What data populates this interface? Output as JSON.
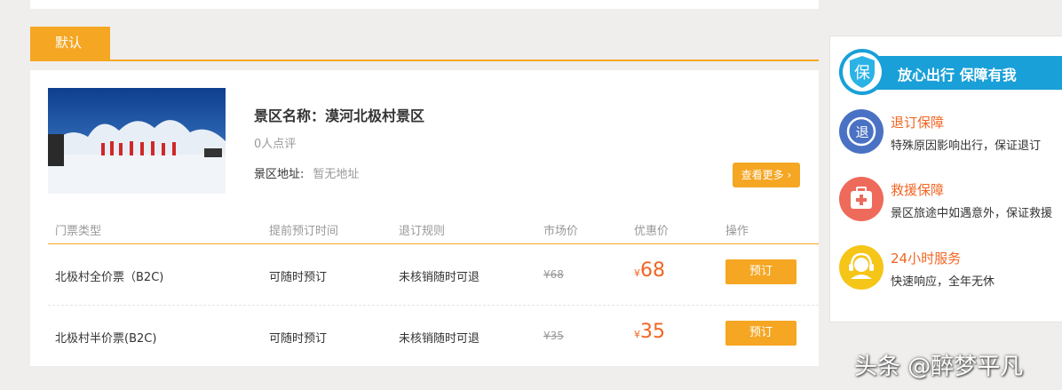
{
  "tab": {
    "label": "默认"
  },
  "scenic": {
    "title": "景区名称：漠河北极村景区",
    "reviews": "0人点评",
    "address_label": "景区地址:",
    "address_value": "暂无地址",
    "more_button": "查看更多"
  },
  "table": {
    "headers": [
      "门票类型",
      "提前预订时间",
      "退订规则",
      "市场价",
      "优惠价",
      "操作"
    ],
    "rows": [
      {
        "type": "北极村全价票（B2C)",
        "advance": "可随时预订",
        "refund": "未核销随时可退",
        "market_price": "¥68",
        "currency": "¥",
        "price": "68",
        "action": "预订"
      },
      {
        "type": "北极村半价票(B2C)",
        "advance": "可随时预订",
        "refund": "未核销随时可退",
        "market_price": "¥35",
        "currency": "¥",
        "price": "35",
        "action": "预订"
      }
    ]
  },
  "sidebar": {
    "badge": "保",
    "banner": "放心出行  保障有我",
    "services": [
      {
        "title": "退订保障",
        "desc": "特殊原因影响出行，保证退订",
        "icon": "refund-icon",
        "icon_text": "退",
        "color": "#4a72c4"
      },
      {
        "title": "救援保障",
        "desc": "景区旅途中如遇意外，保证救援",
        "icon": "first-aid-icon",
        "color": "#ee6a5a"
      },
      {
        "title": "24小时服务",
        "desc": "快速响应，全年无休",
        "icon": "headset-icon",
        "color": "#f5c518"
      }
    ]
  },
  "watermark": "头条 @醉梦平凡",
  "colors": {
    "accent": "#f5a623",
    "price": "#f26522",
    "banner": "#1aa0d8"
  }
}
